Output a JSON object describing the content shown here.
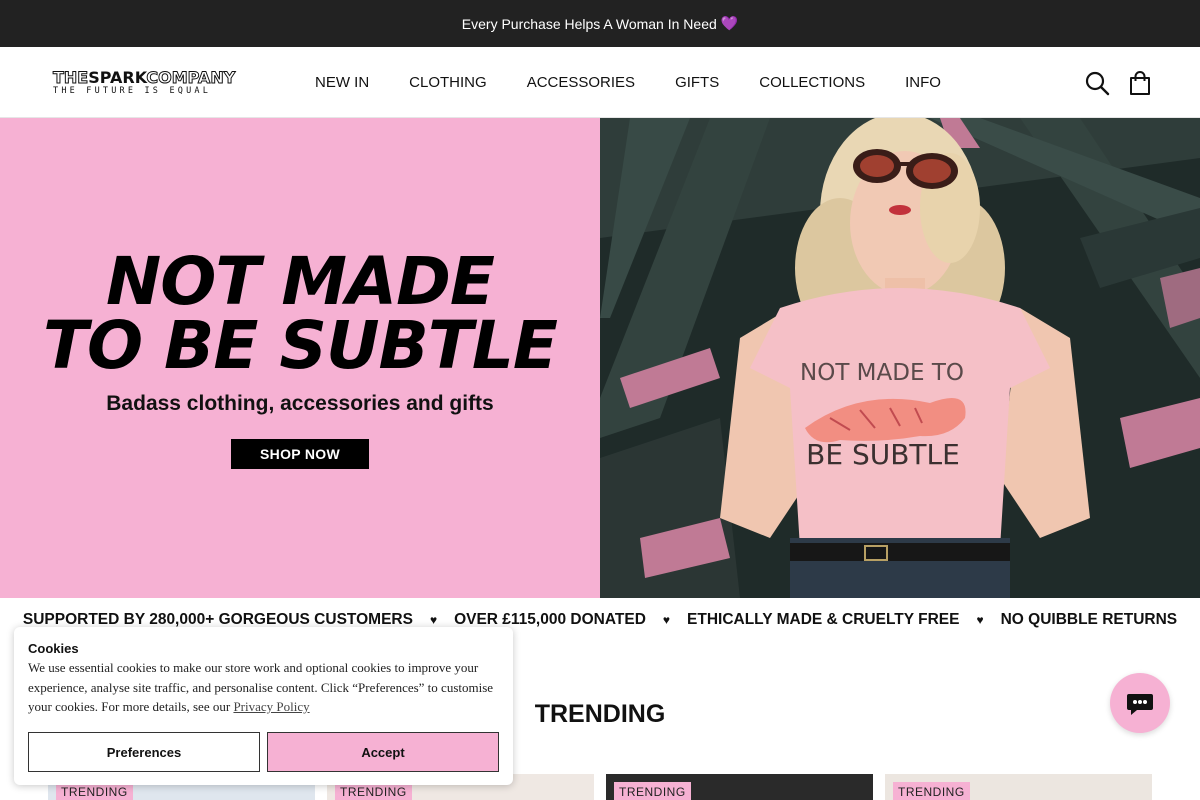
{
  "announcement": {
    "text": "Every Purchase Helps A Woman In Need",
    "emoji": "💜"
  },
  "header": {
    "logo": {
      "the": "THE",
      "spark": "SPARK",
      "company": "COMPANY",
      "tagline": "THE FUTURE IS EQUAL"
    },
    "nav": [
      "NEW IN",
      "CLOTHING",
      "ACCESSORIES",
      "GIFTS",
      "COLLECTIONS",
      "INFO"
    ],
    "icons": [
      "search-icon",
      "bag-icon"
    ]
  },
  "hero": {
    "title_line1": "NOT MADE",
    "title_line2": "TO BE SUBTLE",
    "subtitle": "Badass clothing, accessories and gifts",
    "button": "SHOP NOW",
    "shirt_line1": "NOT MADE TO",
    "shirt_line2": "BE SUBTLE",
    "colors": {
      "pink": "#f6b1d3",
      "black": "#000000"
    }
  },
  "usp": {
    "items": [
      "SUPPORTED BY 280,000+ GORGEOUS CUSTOMERS",
      "OVER £115,000 DONATED",
      "ETHICALLY MADE & CRUELTY FREE",
      "NO QUIBBLE RETURNS"
    ],
    "separator": "♥"
  },
  "trending": {
    "title": "TRENDING",
    "tags": [
      "TRENDING",
      "TRENDING",
      "TRENDING",
      "TRENDING"
    ]
  },
  "cookie": {
    "title": "Cookies",
    "body": "We use essential cookies to make our store work and optional cookies to improve your experience, analyse site traffic, and personalise content. Click “Preferences” to customise your cookies. For more details, see our",
    "link": "Privacy Policy",
    "preferences": "Preferences",
    "accept": "Accept"
  },
  "chat": {
    "icon": "chat-icon"
  }
}
